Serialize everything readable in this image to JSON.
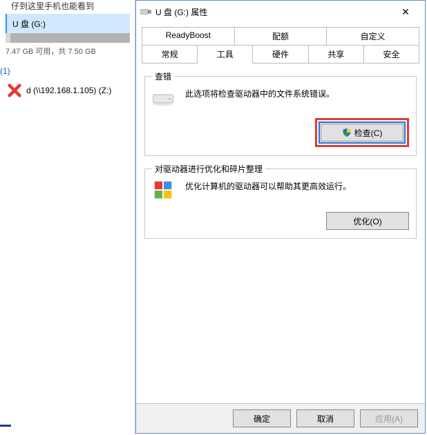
{
  "background": {
    "header_fragment": "仔到这里手机也能看到",
    "selected_drive_label": "U 盘 (G:)",
    "usage_text": "7.47 GB 可用，共 7.50 GB",
    "group_count_label": "(1)",
    "network_drive_label": "d (\\\\192.168.1.105) (Z:)"
  },
  "dialog": {
    "title": "U 盘 (G:) 属性",
    "tabs_row1": [
      "ReadyBoost",
      "配额",
      "自定义"
    ],
    "tabs_row2": [
      "常规",
      "工具",
      "硬件",
      "共享",
      "安全"
    ],
    "active_tab_index": 1,
    "group_check": {
      "legend": "查错",
      "desc": "此选项将检查驱动器中的文件系统错误。",
      "button_label": "检查(C)"
    },
    "group_defrag": {
      "legend": "对驱动器进行优化和碎片整理",
      "desc": "优化计算机的驱动器可以帮助其更高效运行。",
      "button_label": "优化(O)"
    },
    "footer": {
      "ok": "确定",
      "cancel": "取消",
      "apply": "应用(A)"
    }
  }
}
